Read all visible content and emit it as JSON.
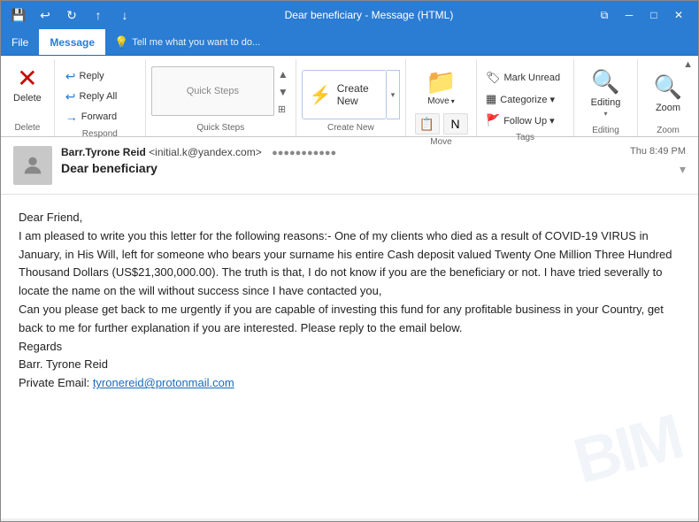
{
  "titleBar": {
    "title": "Dear beneficiary - Message (HTML)",
    "saveIcon": "💾",
    "undoIcon": "↩",
    "redoIcon": "↻",
    "uploadIcon": "↑",
    "downloadIcon": "↓",
    "restoreIcon": "⧉",
    "minimizeIcon": "─",
    "maximizeIcon": "□",
    "closeIcon": "✕"
  },
  "menuBar": {
    "items": [
      {
        "label": "File",
        "active": false
      },
      {
        "label": "Message",
        "active": true
      },
      {
        "label": "Tell me what you want to do...",
        "active": false,
        "isTell": true
      }
    ]
  },
  "ribbon": {
    "groups": {
      "delete": {
        "label": "Delete",
        "icon": "✕",
        "bigLabel": "Delete"
      },
      "respond": {
        "label": "Respond",
        "buttons": [
          {
            "icon": "↩",
            "label": "Reply"
          },
          {
            "icon": "↩↩",
            "label": "Reply All"
          },
          {
            "icon": "→",
            "label": "Forward"
          }
        ]
      },
      "quickSteps": {
        "label": "Quick Steps",
        "expandIcon": "⊞"
      },
      "createNew": {
        "label": "Create New",
        "icon": "⚡"
      },
      "move": {
        "label": "Move",
        "icon": "📁",
        "bigLabel": "Move"
      },
      "tags": {
        "label": "Tags",
        "buttons": [
          {
            "icon": "🏷",
            "label": "Mark Unread"
          },
          {
            "icon": "▦",
            "label": "Categorize ▾"
          },
          {
            "icon": "🚩",
            "label": "Follow Up ▾"
          }
        ]
      },
      "editing": {
        "label": "Editing",
        "icon": "🔍",
        "bigLabel": "Editing"
      },
      "zoom": {
        "label": "Zoom",
        "icon": "🔍",
        "bigLabel": "Zoom"
      }
    }
  },
  "email": {
    "from": "Barr.Tyrone Reid",
    "fromEmail": "<initial.k@yandex.com>",
    "to": "●●●●●●●●●●●",
    "date": "Thu 8:49 PM",
    "subject": "Dear beneficiary",
    "avatarIcon": "person",
    "body": "Dear Friend,\nI am pleased to write you this letter for the following reasons:- One of my clients who died as a result of COVID-19 VIRUS in January, in His Will, left for someone who bears your surname his entire Cash deposit valued Twenty One Million Three Hundred Thousand Dollars (US$21,300,000.00). The truth is that, I do not know if you are the beneficiary or not. I have tried severally to locate the name on the will without success since I have contacted you,\nCan you please get back to me urgently if you are capable of investing this fund for any profitable business in your Country, get back to me for further explanation if you are interested. Please reply to the email below.\nRegards\nBarr. Tyrone Reid\nPrivate Email: tyronereid@protonmail.com",
    "link": "tyronereid@protonmail.com",
    "watermark": "BIM"
  }
}
